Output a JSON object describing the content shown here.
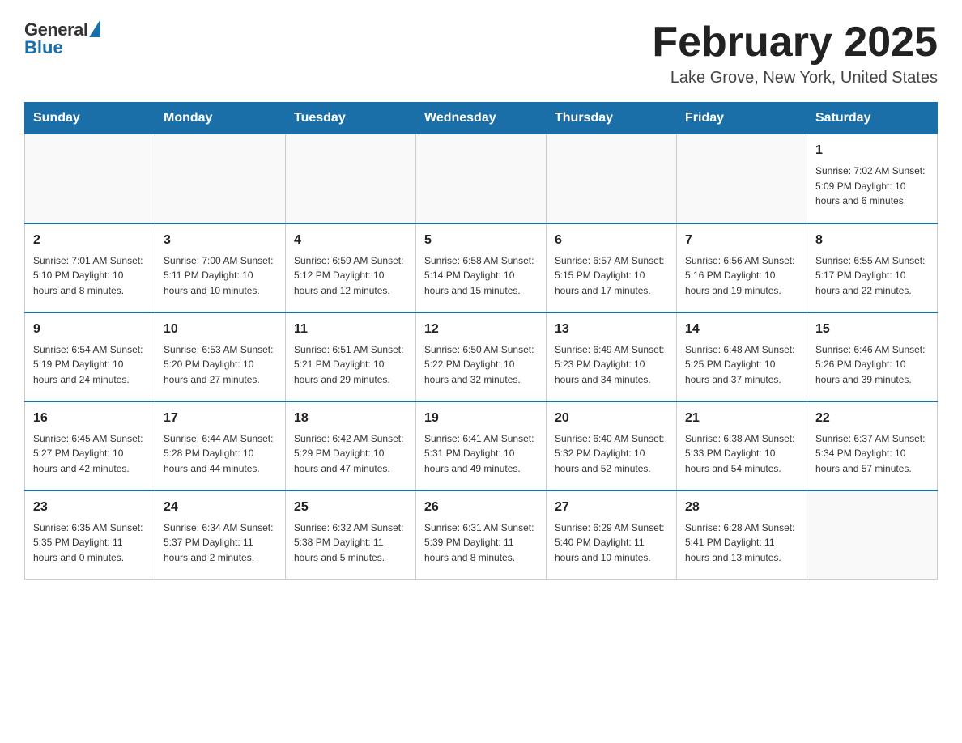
{
  "header": {
    "logo_general": "General",
    "logo_blue": "Blue",
    "title": "February 2025",
    "location": "Lake Grove, New York, United States"
  },
  "days_of_week": [
    "Sunday",
    "Monday",
    "Tuesday",
    "Wednesday",
    "Thursday",
    "Friday",
    "Saturday"
  ],
  "weeks": [
    [
      {
        "day": "",
        "info": ""
      },
      {
        "day": "",
        "info": ""
      },
      {
        "day": "",
        "info": ""
      },
      {
        "day": "",
        "info": ""
      },
      {
        "day": "",
        "info": ""
      },
      {
        "day": "",
        "info": ""
      },
      {
        "day": "1",
        "info": "Sunrise: 7:02 AM\nSunset: 5:09 PM\nDaylight: 10 hours and 6 minutes."
      }
    ],
    [
      {
        "day": "2",
        "info": "Sunrise: 7:01 AM\nSunset: 5:10 PM\nDaylight: 10 hours and 8 minutes."
      },
      {
        "day": "3",
        "info": "Sunrise: 7:00 AM\nSunset: 5:11 PM\nDaylight: 10 hours and 10 minutes."
      },
      {
        "day": "4",
        "info": "Sunrise: 6:59 AM\nSunset: 5:12 PM\nDaylight: 10 hours and 12 minutes."
      },
      {
        "day": "5",
        "info": "Sunrise: 6:58 AM\nSunset: 5:14 PM\nDaylight: 10 hours and 15 minutes."
      },
      {
        "day": "6",
        "info": "Sunrise: 6:57 AM\nSunset: 5:15 PM\nDaylight: 10 hours and 17 minutes."
      },
      {
        "day": "7",
        "info": "Sunrise: 6:56 AM\nSunset: 5:16 PM\nDaylight: 10 hours and 19 minutes."
      },
      {
        "day": "8",
        "info": "Sunrise: 6:55 AM\nSunset: 5:17 PM\nDaylight: 10 hours and 22 minutes."
      }
    ],
    [
      {
        "day": "9",
        "info": "Sunrise: 6:54 AM\nSunset: 5:19 PM\nDaylight: 10 hours and 24 minutes."
      },
      {
        "day": "10",
        "info": "Sunrise: 6:53 AM\nSunset: 5:20 PM\nDaylight: 10 hours and 27 minutes."
      },
      {
        "day": "11",
        "info": "Sunrise: 6:51 AM\nSunset: 5:21 PM\nDaylight: 10 hours and 29 minutes."
      },
      {
        "day": "12",
        "info": "Sunrise: 6:50 AM\nSunset: 5:22 PM\nDaylight: 10 hours and 32 minutes."
      },
      {
        "day": "13",
        "info": "Sunrise: 6:49 AM\nSunset: 5:23 PM\nDaylight: 10 hours and 34 minutes."
      },
      {
        "day": "14",
        "info": "Sunrise: 6:48 AM\nSunset: 5:25 PM\nDaylight: 10 hours and 37 minutes."
      },
      {
        "day": "15",
        "info": "Sunrise: 6:46 AM\nSunset: 5:26 PM\nDaylight: 10 hours and 39 minutes."
      }
    ],
    [
      {
        "day": "16",
        "info": "Sunrise: 6:45 AM\nSunset: 5:27 PM\nDaylight: 10 hours and 42 minutes."
      },
      {
        "day": "17",
        "info": "Sunrise: 6:44 AM\nSunset: 5:28 PM\nDaylight: 10 hours and 44 minutes."
      },
      {
        "day": "18",
        "info": "Sunrise: 6:42 AM\nSunset: 5:29 PM\nDaylight: 10 hours and 47 minutes."
      },
      {
        "day": "19",
        "info": "Sunrise: 6:41 AM\nSunset: 5:31 PM\nDaylight: 10 hours and 49 minutes."
      },
      {
        "day": "20",
        "info": "Sunrise: 6:40 AM\nSunset: 5:32 PM\nDaylight: 10 hours and 52 minutes."
      },
      {
        "day": "21",
        "info": "Sunrise: 6:38 AM\nSunset: 5:33 PM\nDaylight: 10 hours and 54 minutes."
      },
      {
        "day": "22",
        "info": "Sunrise: 6:37 AM\nSunset: 5:34 PM\nDaylight: 10 hours and 57 minutes."
      }
    ],
    [
      {
        "day": "23",
        "info": "Sunrise: 6:35 AM\nSunset: 5:35 PM\nDaylight: 11 hours and 0 minutes."
      },
      {
        "day": "24",
        "info": "Sunrise: 6:34 AM\nSunset: 5:37 PM\nDaylight: 11 hours and 2 minutes."
      },
      {
        "day": "25",
        "info": "Sunrise: 6:32 AM\nSunset: 5:38 PM\nDaylight: 11 hours and 5 minutes."
      },
      {
        "day": "26",
        "info": "Sunrise: 6:31 AM\nSunset: 5:39 PM\nDaylight: 11 hours and 8 minutes."
      },
      {
        "day": "27",
        "info": "Sunrise: 6:29 AM\nSunset: 5:40 PM\nDaylight: 11 hours and 10 minutes."
      },
      {
        "day": "28",
        "info": "Sunrise: 6:28 AM\nSunset: 5:41 PM\nDaylight: 11 hours and 13 minutes."
      },
      {
        "day": "",
        "info": ""
      }
    ]
  ]
}
